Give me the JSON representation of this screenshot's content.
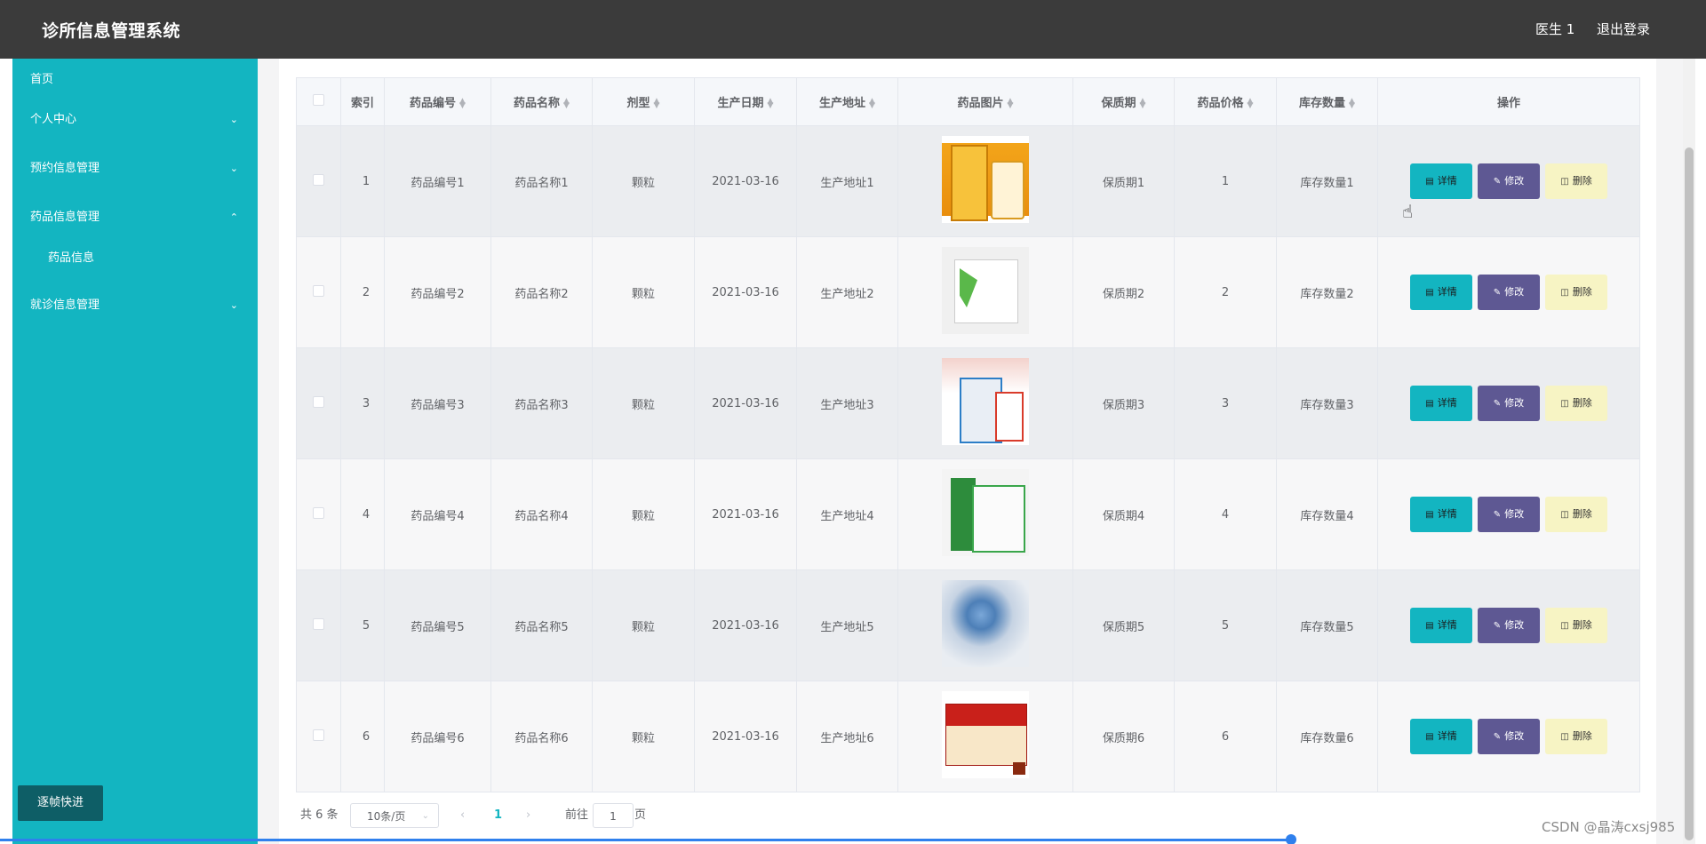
{
  "app": {
    "title": "诊所信息管理系统",
    "user": "医生 1",
    "logout": "退出登录"
  },
  "sidebar": {
    "items": [
      {
        "label": "首页"
      },
      {
        "label": "个人中心",
        "icon": "chevron-down-icon"
      },
      {
        "label": "预约信息管理",
        "icon": "chevron-down-icon"
      },
      {
        "label": "药品信息管理",
        "icon": "chevron-up-icon",
        "expanded": true
      },
      {
        "label": "药品信息",
        "sub": true
      },
      {
        "label": "就诊信息管理",
        "icon": "chevron-down-icon"
      }
    ],
    "frame_button": "逐帧快进"
  },
  "table": {
    "headers": [
      "索引",
      "药品编号",
      "药品名称",
      "剂型",
      "生产日期",
      "生产地址",
      "药品图片",
      "保质期",
      "药品价格",
      "库存数量",
      "操作"
    ],
    "rows": [
      {
        "index": "1",
        "code": "药品编号1",
        "name": "药品名称1",
        "form": "颗粒",
        "date": "2021-03-16",
        "address": "生产地址1",
        "shelf": "保质期1",
        "price": "1",
        "stock": "库存数量1"
      },
      {
        "index": "2",
        "code": "药品编号2",
        "name": "药品名称2",
        "form": "颗粒",
        "date": "2021-03-16",
        "address": "生产地址2",
        "shelf": "保质期2",
        "price": "2",
        "stock": "库存数量2"
      },
      {
        "index": "3",
        "code": "药品编号3",
        "name": "药品名称3",
        "form": "颗粒",
        "date": "2021-03-16",
        "address": "生产地址3",
        "shelf": "保质期3",
        "price": "3",
        "stock": "库存数量3"
      },
      {
        "index": "4",
        "code": "药品编号4",
        "name": "药品名称4",
        "form": "颗粒",
        "date": "2021-03-16",
        "address": "生产地址4",
        "shelf": "保质期4",
        "price": "4",
        "stock": "库存数量4"
      },
      {
        "index": "5",
        "code": "药品编号5",
        "name": "药品名称5",
        "form": "颗粒",
        "date": "2021-03-16",
        "address": "生产地址5",
        "shelf": "保质期5",
        "price": "5",
        "stock": "库存数量5"
      },
      {
        "index": "6",
        "code": "药品编号6",
        "name": "药品名称6",
        "form": "颗粒",
        "date": "2021-03-16",
        "address": "生产地址6",
        "shelf": "保质期6",
        "price": "6",
        "stock": "库存数量6"
      }
    ],
    "actions": {
      "detail": "详情",
      "edit": "修改",
      "delete": "删除"
    }
  },
  "pagination": {
    "total": "共 6 条",
    "page_size": "10条/页",
    "current_page": "1",
    "goto_label": "前往",
    "goto_value": "1",
    "page_suffix": "页"
  },
  "watermark": "CSDN @晶涛cxsj985",
  "colors": {
    "topbar": "#3b3b3b",
    "sidebar": "#13b5c1",
    "detail_button": "#13b5c1",
    "edit_button": "#5e5893",
    "delete_button": "#f7f4c4"
  }
}
